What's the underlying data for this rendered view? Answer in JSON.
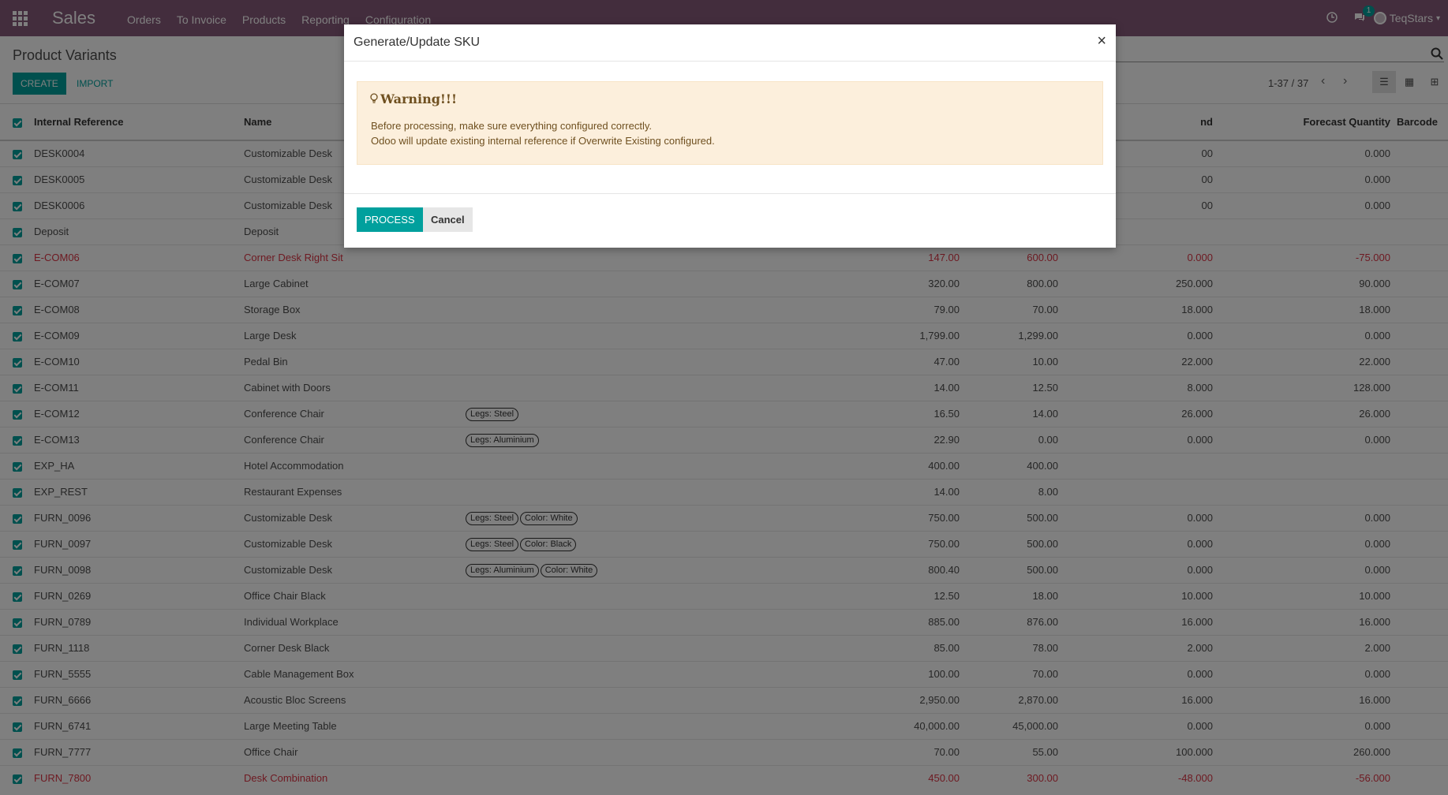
{
  "app": {
    "brand": "Sales",
    "menu": [
      "Orders",
      "To Invoice",
      "Products",
      "Reporting",
      "Configuration"
    ],
    "messages_badge": "1",
    "user": "TeqStars"
  },
  "control": {
    "breadcrumb": "Product Variants",
    "create_label": "CREATE",
    "import_label": "IMPORT",
    "pager": "1-37 / 37"
  },
  "table": {
    "headers": {
      "internal_reference": "Internal Reference",
      "name": "Name",
      "on_hand_partial": "nd",
      "forecast": "Forecast Quantity",
      "barcode": "Barcode"
    },
    "rows": [
      {
        "ref": "DESK0004",
        "name": "Customizable Desk",
        "tags": [],
        "price": "",
        "cost": "",
        "onhand": "00",
        "forecast": "0.000",
        "red": false
      },
      {
        "ref": "DESK0005",
        "name": "Customizable Desk",
        "tags": [],
        "price": "",
        "cost": "",
        "onhand": "00",
        "forecast": "0.000",
        "red": false
      },
      {
        "ref": "DESK0006",
        "name": "Customizable Desk",
        "tags": [],
        "price": "",
        "cost": "",
        "onhand": "00",
        "forecast": "0.000",
        "red": false
      },
      {
        "ref": "Deposit",
        "name": "Deposit",
        "tags": [],
        "price": "",
        "cost": "",
        "onhand": "",
        "forecast": "",
        "red": false
      },
      {
        "ref": "E-COM06",
        "name": "Corner Desk Right Sit",
        "tags": [],
        "price": "147.00",
        "cost": "600.00",
        "onhand": "0.000",
        "forecast": "-75.000",
        "red": true
      },
      {
        "ref": "E-COM07",
        "name": "Large Cabinet",
        "tags": [],
        "price": "320.00",
        "cost": "800.00",
        "onhand": "250.000",
        "forecast": "90.000",
        "red": false
      },
      {
        "ref": "E-COM08",
        "name": "Storage Box",
        "tags": [],
        "price": "79.00",
        "cost": "70.00",
        "onhand": "18.000",
        "forecast": "18.000",
        "red": false
      },
      {
        "ref": "E-COM09",
        "name": "Large Desk",
        "tags": [],
        "price": "1,799.00",
        "cost": "1,299.00",
        "onhand": "0.000",
        "forecast": "0.000",
        "red": false
      },
      {
        "ref": "E-COM10",
        "name": "Pedal Bin",
        "tags": [],
        "price": "47.00",
        "cost": "10.00",
        "onhand": "22.000",
        "forecast": "22.000",
        "red": false
      },
      {
        "ref": "E-COM11",
        "name": "Cabinet with Doors",
        "tags": [],
        "price": "14.00",
        "cost": "12.50",
        "onhand": "8.000",
        "forecast": "128.000",
        "red": false
      },
      {
        "ref": "E-COM12",
        "name": "Conference Chair",
        "tags": [
          "Legs: Steel"
        ],
        "price": "16.50",
        "cost": "14.00",
        "onhand": "26.000",
        "forecast": "26.000",
        "red": false
      },
      {
        "ref": "E-COM13",
        "name": "Conference Chair",
        "tags": [
          "Legs: Aluminium"
        ],
        "price": "22.90",
        "cost": "0.00",
        "onhand": "0.000",
        "forecast": "0.000",
        "red": false
      },
      {
        "ref": "EXP_HA",
        "name": "Hotel Accommodation",
        "tags": [],
        "price": "400.00",
        "cost": "400.00",
        "onhand": "",
        "forecast": "",
        "red": false
      },
      {
        "ref": "EXP_REST",
        "name": "Restaurant Expenses",
        "tags": [],
        "price": "14.00",
        "cost": "8.00",
        "onhand": "",
        "forecast": "",
        "red": false
      },
      {
        "ref": "FURN_0096",
        "name": "Customizable Desk",
        "tags": [
          "Legs: Steel",
          "Color: White"
        ],
        "price": "750.00",
        "cost": "500.00",
        "onhand": "0.000",
        "forecast": "0.000",
        "red": false
      },
      {
        "ref": "FURN_0097",
        "name": "Customizable Desk",
        "tags": [
          "Legs: Steel",
          "Color: Black"
        ],
        "price": "750.00",
        "cost": "500.00",
        "onhand": "0.000",
        "forecast": "0.000",
        "red": false
      },
      {
        "ref": "FURN_0098",
        "name": "Customizable Desk",
        "tags": [
          "Legs: Aluminium",
          "Color: White"
        ],
        "price": "800.40",
        "cost": "500.00",
        "onhand": "0.000",
        "forecast": "0.000",
        "red": false
      },
      {
        "ref": "FURN_0269",
        "name": "Office Chair Black",
        "tags": [],
        "price": "12.50",
        "cost": "18.00",
        "onhand": "10.000",
        "forecast": "10.000",
        "red": false
      },
      {
        "ref": "FURN_0789",
        "name": "Individual Workplace",
        "tags": [],
        "price": "885.00",
        "cost": "876.00",
        "onhand": "16.000",
        "forecast": "16.000",
        "red": false
      },
      {
        "ref": "FURN_1118",
        "name": "Corner Desk Black",
        "tags": [],
        "price": "85.00",
        "cost": "78.00",
        "onhand": "2.000",
        "forecast": "2.000",
        "red": false
      },
      {
        "ref": "FURN_5555",
        "name": "Cable Management Box",
        "tags": [],
        "price": "100.00",
        "cost": "70.00",
        "onhand": "0.000",
        "forecast": "0.000",
        "red": false
      },
      {
        "ref": "FURN_6666",
        "name": "Acoustic Bloc Screens",
        "tags": [],
        "price": "2,950.00",
        "cost": "2,870.00",
        "onhand": "16.000",
        "forecast": "16.000",
        "red": false
      },
      {
        "ref": "FURN_6741",
        "name": "Large Meeting Table",
        "tags": [],
        "price": "40,000.00",
        "cost": "45,000.00",
        "onhand": "0.000",
        "forecast": "0.000",
        "red": false
      },
      {
        "ref": "FURN_7777",
        "name": "Office Chair",
        "tags": [],
        "price": "70.00",
        "cost": "55.00",
        "onhand": "100.000",
        "forecast": "260.000",
        "red": false
      },
      {
        "ref": "FURN_7800",
        "name": "Desk Combination",
        "tags": [],
        "price": "450.00",
        "cost": "300.00",
        "onhand": "-48.000",
        "forecast": "-56.000",
        "red": true
      }
    ]
  },
  "modal": {
    "title": "Generate/Update SKU",
    "close": "×",
    "warning_title": "Warning!!!",
    "warning_line1": "Before processing, make sure everything configured correctly.",
    "warning_line2": "Odoo will update existing internal reference if Overwrite Existing configured.",
    "process_label": "PROCESS",
    "cancel_label": "Cancel"
  },
  "colors": {
    "navbar": "#875a7b",
    "primary": "#00a09d",
    "alert_bg": "#fcefdc",
    "negative": "#dc3545"
  },
  "icons": [
    "apps-icon",
    "clock-icon",
    "chat-icon",
    "globe-icon",
    "search-icon",
    "chevron-left-icon",
    "chevron-right-icon",
    "list-view-icon",
    "kanban-view-icon",
    "grid-view-icon",
    "lightbulb-icon",
    "close-icon"
  ]
}
